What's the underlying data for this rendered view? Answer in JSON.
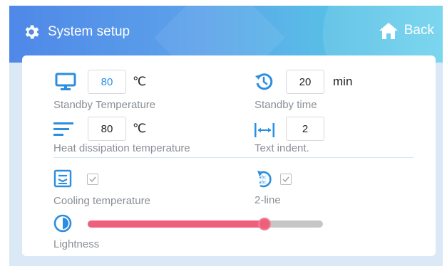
{
  "header": {
    "title": "System setup",
    "back_label": "Back",
    "title_icon": "gear-icon",
    "back_icon": "home-icon"
  },
  "settings": {
    "standby_temperature": {
      "value": "80",
      "unit": "℃",
      "label": "Standby Temperature",
      "icon": "monitor-icon"
    },
    "standby_time": {
      "value": "20",
      "unit": "min",
      "label": "Standby time",
      "icon": "history-clock-icon"
    },
    "heat_dissipation_temperature": {
      "value": "80",
      "unit": "℃",
      "label": "Heat dissipation temperature",
      "icon": "lines-icon"
    },
    "text_indent": {
      "value": "2",
      "label": "Text indent.",
      "icon": "indent-arrows-icon"
    },
    "cooling_temperature": {
      "checked": true,
      "label": "Cooling temperature",
      "icon": "cooling-icon"
    },
    "two_line": {
      "checked": true,
      "label": "2-line",
      "icon": "abc-rotate-icon"
    },
    "lightness": {
      "level": 0.75,
      "label": "Lightness",
      "icon": "contrast-icon"
    }
  },
  "colors": {
    "accent": "#2b8ee0",
    "slider_fill": "#ef5f7c",
    "slider_track": "#c6c6c6",
    "label": "#8a8f95"
  }
}
